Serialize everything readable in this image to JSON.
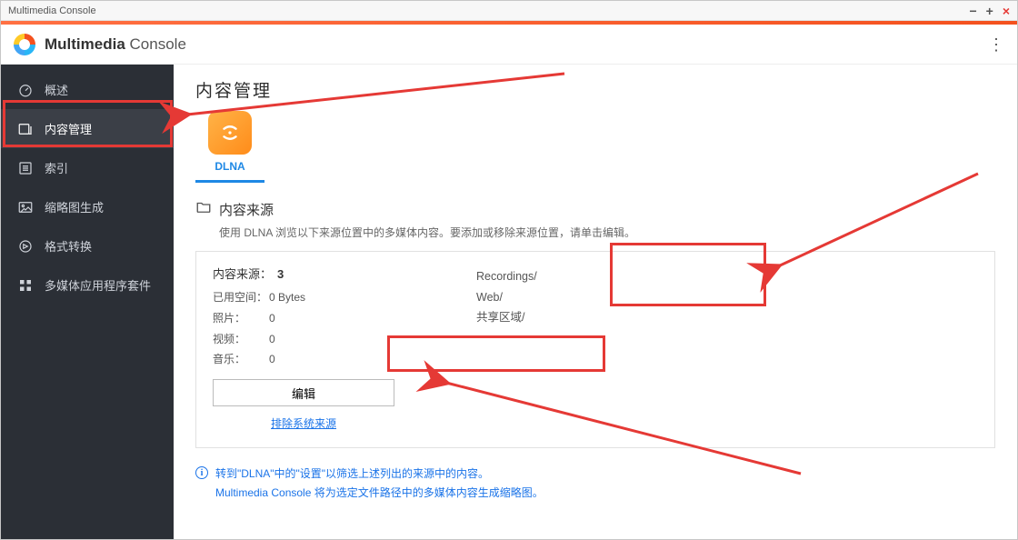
{
  "window": {
    "title": "Multimedia Console"
  },
  "app": {
    "title_bold": "Multimedia",
    "title_light": " Console"
  },
  "sidebar": {
    "items": [
      {
        "label": "概述"
      },
      {
        "label": "内容管理"
      },
      {
        "label": "索引"
      },
      {
        "label": "缩略图生成"
      },
      {
        "label": "格式转换"
      },
      {
        "label": "多媒体应用程序套件"
      }
    ]
  },
  "page": {
    "title": "内容管理",
    "tab_label": "DLNA",
    "section_title": "内容来源",
    "section_desc": "使用 DLNA 浏览以下来源位置中的多媒体内容。要添加或移除来源位置，请单击编辑。",
    "count_label": "内容来源：",
    "count_value": "3",
    "stats": {
      "used_label": "已用空间：",
      "used_value": "0 Bytes",
      "photo_label": "照片：",
      "photo_value": "0",
      "video_label": "视频：",
      "video_value": "0",
      "music_label": "音乐：",
      "music_value": "0"
    },
    "edit_button": "编辑",
    "exclude_link": "排除系统来源",
    "paths": [
      "Recordings/",
      "Web/",
      "共享区域/"
    ],
    "info_line1": "转到\"DLNA\"中的\"设置\"以筛选上述列出的来源中的内容。",
    "info_line2": "Multimedia Console 将为选定文件路径中的多媒体内容生成缩略图。"
  }
}
